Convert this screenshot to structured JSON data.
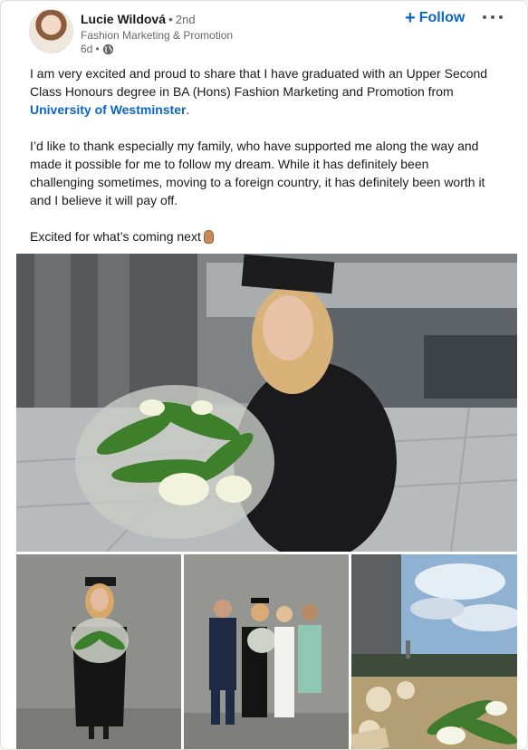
{
  "post": {
    "author": {
      "name": "Lucie Wildová",
      "degree": "2nd",
      "headline": "Fashion Marketing & Promotion",
      "time": "6d",
      "visibility_icon": "globe-icon"
    },
    "follow_label": "Follow",
    "text": {
      "p1_before": "I am very excited and proud to share that I have graduated with an Upper Second",
      "p1_line2": "Class Honours degree in BA (Hons) Fashion Marketing and Promotion from",
      "p1_link": "University of Westminster",
      "p1_after": ".",
      "p2_l1": "I’d like to thank especially my family, who have supported me along the way and",
      "p2_l2": "made it possible for me to follow my dream. While it has definitely been",
      "p2_l3": "challenging sometimes, moving to a foreign country, it has definitely been worth it",
      "p2_l4": "and I believe it will pay off.",
      "p3": "Excited for what’s coming next"
    },
    "images": [
      "graduation-portrait-with-flowers",
      "graduation-full-length-photo",
      "graduation-family-group-photo",
      "flowers-and-city-view-photo"
    ],
    "colors": {
      "link": "#0a66c2",
      "text": "#000000e6",
      "secondary": "#666666"
    }
  }
}
